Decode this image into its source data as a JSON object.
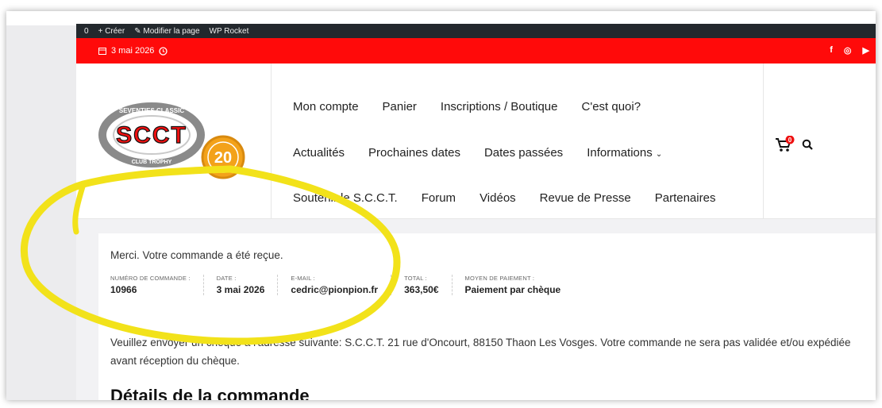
{
  "adminbar": {
    "count": "0",
    "create": "Créer",
    "edit_page": "Modifier la page",
    "wp_rocket": "WP Rocket"
  },
  "topbar": {
    "date": "3 mai 2026",
    "social_icons": [
      "facebook-icon",
      "instagram-icon",
      "youtube-icon"
    ],
    "color": "#ff0a0a"
  },
  "logo": {
    "main": "SCCT",
    "ring_top": "SEVENTIES CLASSIC",
    "ring_bottom": "CLUB TROPHY",
    "badge": "20"
  },
  "nav": {
    "row1": [
      "Mon compte",
      "Panier",
      "Inscriptions / Boutique",
      "C'est quoi?"
    ],
    "row2": [
      "Actualités",
      "Prochaines dates",
      "Dates passées",
      "Informations"
    ],
    "row3": [
      "Soutenir le S.C.C.T.",
      "Forum",
      "Vidéos",
      "Revue de Presse",
      "Partenaires"
    ]
  },
  "cart": {
    "count": "0"
  },
  "order": {
    "thanks": "Merci. Votre commande a été reçue.",
    "overview": [
      {
        "label": "NUMÉRO DE COMMANDE :",
        "value": "10966"
      },
      {
        "label": "DATE :",
        "value": "3 mai 2026"
      },
      {
        "label": "E-MAIL :",
        "value": "cedric@pionpion.fr"
      },
      {
        "label": "TOTAL :",
        "value": "363,50€"
      },
      {
        "label": "MOYEN DE PAIEMENT :",
        "value": "Paiement par chèque"
      }
    ],
    "instructions": "Veuillez envoyer un chèque à l'adresse suivante: S.C.C.T. 21 rue d'Oncourt, 88150 Thaon Les Vosges. Votre commande ne sera pas validée et/ou expédiée avant réception du chèque.",
    "details_title": "Détails de la commande"
  },
  "annotation_color": "#f2e21a"
}
